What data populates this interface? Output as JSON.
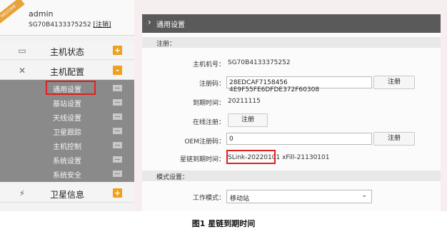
{
  "sidebar": {
    "ribbon_text": "WELCOME",
    "username": "admin",
    "device_id": "SG70B4133375252",
    "logout_label": "[注销]",
    "groups": [
      {
        "label": "主机状态",
        "icon": "monitor-icon",
        "badge": "+"
      },
      {
        "label": "主机配置",
        "icon": "tools-icon",
        "badge": "-"
      },
      {
        "label": "卫星信息",
        "icon": "satellite-icon",
        "badge": "+"
      }
    ],
    "subitems": [
      "通用设置",
      "基站设置",
      "天线设置",
      "卫星跟踪",
      "主机控制",
      "系统设置",
      "系统安全"
    ]
  },
  "main": {
    "breadcrumb": "通用设置",
    "sections": {
      "register": "注册：",
      "mode": "模式设置："
    },
    "fields": {
      "host_id_label": "主机机号：",
      "host_id_value": "SG70B4133375252",
      "reg_code_label": "注册码：",
      "reg_code_value": "28EDCAF7158456 4E9F55FE6DFDE372F60308",
      "reg_button": "注册",
      "expire_label": "到期时间：",
      "expire_value": "20211115",
      "online_reg_label": "在线注册：",
      "online_reg_button": "注册",
      "oem_label": "OEM注册码：",
      "oem_value": "0",
      "oem_button": "注册",
      "star_expire_label": "星链到期时间：",
      "star_expire_value_a": "SLink-20220101",
      "star_expire_value_b": "xFill-21130101",
      "mode_label": "工作模式：",
      "mode_value": "移动站"
    }
  },
  "caption": "图1 星链到期时间",
  "colors": {
    "accent": "#f0a020",
    "highlight": "#e02020",
    "header": "#5a5a5a",
    "submenu": "#8a8a8a"
  }
}
